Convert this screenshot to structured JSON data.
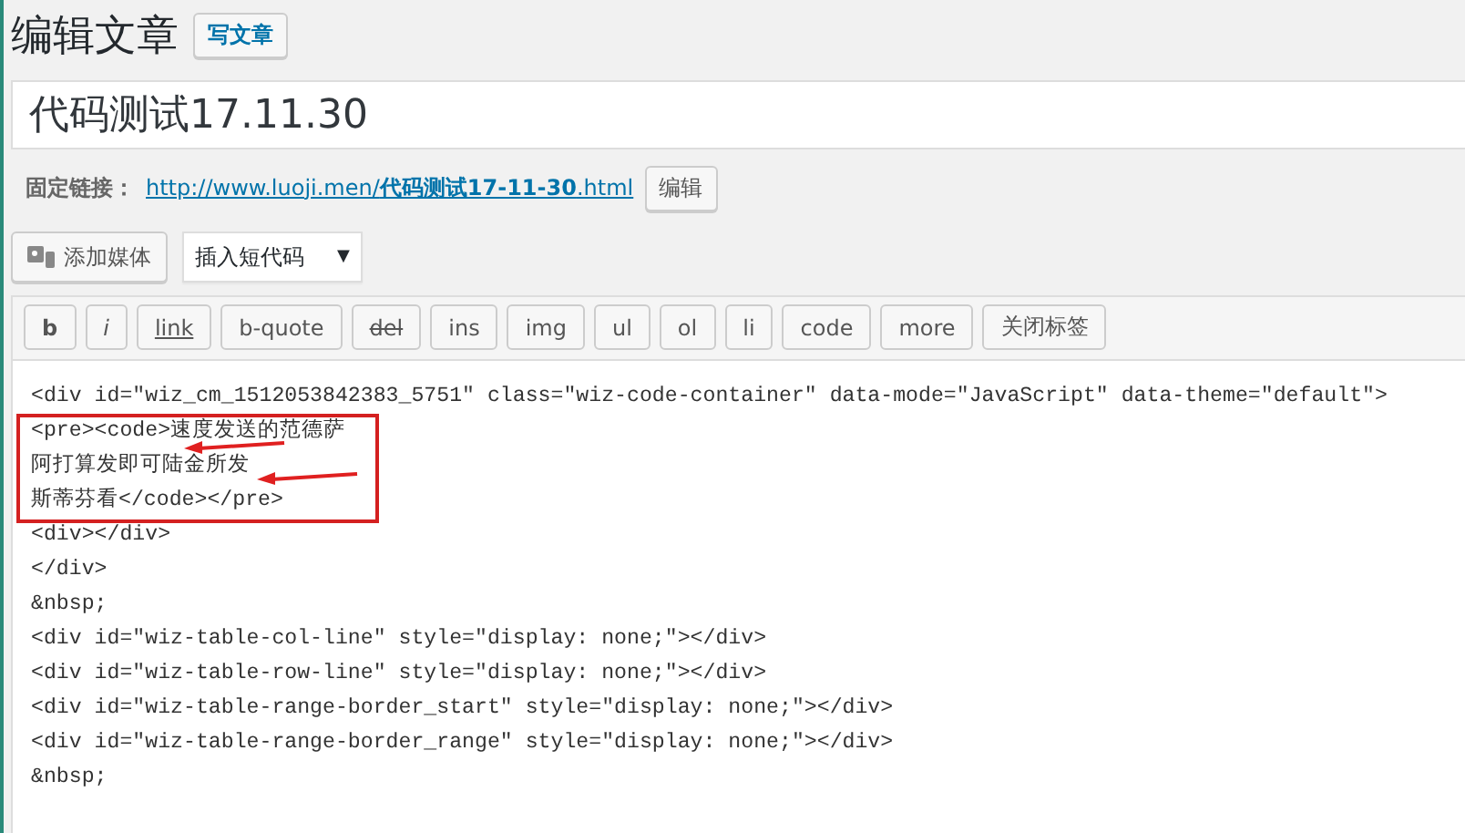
{
  "heading": {
    "title": "编辑文章",
    "button": "写文章"
  },
  "post_title": {
    "value": "代码测试17.11.30"
  },
  "permalink": {
    "label": "固定链接：",
    "url_base": "http://www.luoji.men/",
    "url_slug": "代码测试17-11-30",
    "url_ext": ".html",
    "button": "编辑"
  },
  "media": {
    "add_media": "添加媒体",
    "shortcode": "插入短代码",
    "caret": "▼"
  },
  "quicktags": [
    {
      "label": "b",
      "kind": "bold"
    },
    {
      "label": "i",
      "kind": "italic"
    },
    {
      "label": "link",
      "kind": "link"
    },
    {
      "label": "b-quote",
      "kind": "plain"
    },
    {
      "label": "del",
      "kind": "strike"
    },
    {
      "label": "ins",
      "kind": "plain"
    },
    {
      "label": "img",
      "kind": "plain"
    },
    {
      "label": "ul",
      "kind": "plain"
    },
    {
      "label": "ol",
      "kind": "plain"
    },
    {
      "label": "li",
      "kind": "plain"
    },
    {
      "label": "code",
      "kind": "plain"
    },
    {
      "label": "more",
      "kind": "plain"
    },
    {
      "label": "关闭标签",
      "kind": "plain"
    }
  ],
  "code_lines": [
    {
      "text": "<div id=\"wiz_cm_1512053842383_5751\" class=\"wiz-code-container\" data-mode=\"JavaScript\" data-theme=\"default\">",
      "boxed": false,
      "arrow": false
    },
    {
      "text": "<pre><code>速度发送的范德萨",
      "boxed": true,
      "arrow": true
    },
    {
      "text": "阿打算发即可陆金所发",
      "boxed": true,
      "arrow": true
    },
    {
      "text": "斯蒂芬看</code></pre>",
      "boxed": true,
      "arrow": false
    },
    {
      "text": "<div></div>",
      "boxed": false,
      "arrow": false
    },
    {
      "text": "</div>",
      "boxed": false,
      "arrow": false
    },
    {
      "text": "&nbsp;",
      "boxed": false,
      "arrow": false
    },
    {
      "text": "<div id=\"wiz-table-col-line\" style=\"display: none;\"></div>",
      "boxed": false,
      "arrow": false
    },
    {
      "text": "<div id=\"wiz-table-row-line\" style=\"display: none;\"></div>",
      "boxed": false,
      "arrow": false
    },
    {
      "text": "<div id=\"wiz-table-range-border_start\" style=\"display: none;\"></div>",
      "boxed": false,
      "arrow": false
    },
    {
      "text": "<div id=\"wiz-table-range-border_range\" style=\"display: none;\"></div>",
      "boxed": false,
      "arrow": false
    },
    {
      "text": "&nbsp;",
      "boxed": false,
      "arrow": false
    }
  ]
}
